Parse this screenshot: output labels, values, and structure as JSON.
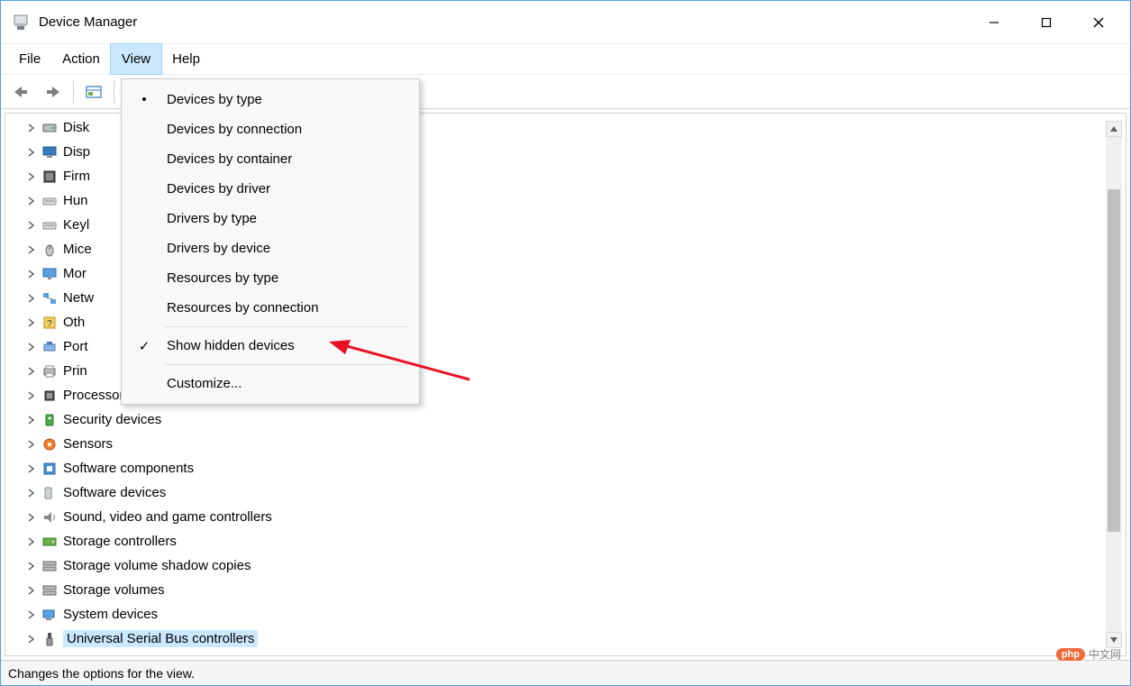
{
  "window": {
    "title": "Device Manager"
  },
  "menubar": {
    "items": [
      {
        "label": "File",
        "active": false
      },
      {
        "label": "Action",
        "active": false
      },
      {
        "label": "View",
        "active": true
      },
      {
        "label": "Help",
        "active": false
      }
    ]
  },
  "view_menu": {
    "items": [
      {
        "label": "Devices by type",
        "mark": "dot"
      },
      {
        "label": "Devices by connection",
        "mark": ""
      },
      {
        "label": "Devices by container",
        "mark": ""
      },
      {
        "label": "Devices by driver",
        "mark": ""
      },
      {
        "label": "Drivers by type",
        "mark": ""
      },
      {
        "label": "Drivers by device",
        "mark": ""
      },
      {
        "label": "Resources by type",
        "mark": ""
      },
      {
        "label": "Resources by connection",
        "mark": ""
      }
    ],
    "show_hidden": {
      "label": "Show hidden devices",
      "mark": "check"
    },
    "customize": {
      "label": "Customize..."
    }
  },
  "tree": {
    "nodes": [
      {
        "label": "Disk",
        "icon": "disk",
        "truncated": true
      },
      {
        "label": "Disp",
        "icon": "display",
        "truncated": true
      },
      {
        "label": "Firm",
        "icon": "firmware",
        "truncated": true
      },
      {
        "label": "Hun",
        "icon": "keyboard",
        "truncated": true
      },
      {
        "label": "Keyl",
        "icon": "keyboard",
        "truncated": true
      },
      {
        "label": "Mice",
        "icon": "mouse",
        "truncated": true
      },
      {
        "label": "Mor",
        "icon": "monitor",
        "truncated": true
      },
      {
        "label": "Netw",
        "icon": "network",
        "truncated": true
      },
      {
        "label": "Oth",
        "icon": "other",
        "truncated": true
      },
      {
        "label": "Port",
        "icon": "port",
        "truncated": true
      },
      {
        "label": "Prin",
        "icon": "printer",
        "truncated": true
      },
      {
        "label": "Processors",
        "icon": "cpu",
        "truncated": false
      },
      {
        "label": "Security devices",
        "icon": "security",
        "truncated": false
      },
      {
        "label": "Sensors",
        "icon": "sensor",
        "truncated": false
      },
      {
        "label": "Software components",
        "icon": "software-comp",
        "truncated": false
      },
      {
        "label": "Software devices",
        "icon": "software-dev",
        "truncated": false
      },
      {
        "label": "Sound, video and game controllers",
        "icon": "sound",
        "truncated": false
      },
      {
        "label": "Storage controllers",
        "icon": "storage-ctrl",
        "truncated": false
      },
      {
        "label": "Storage volume shadow copies",
        "icon": "storage-vol",
        "truncated": false
      },
      {
        "label": "Storage volumes",
        "icon": "storage-vol",
        "truncated": false
      },
      {
        "label": "System devices",
        "icon": "system",
        "truncated": false
      },
      {
        "label": "Universal Serial Bus controllers",
        "icon": "usb",
        "truncated": false,
        "selected": true
      }
    ]
  },
  "statusbar": {
    "text": "Changes the options for the view."
  },
  "watermark": {
    "bubble": "php",
    "text": "中文网"
  }
}
